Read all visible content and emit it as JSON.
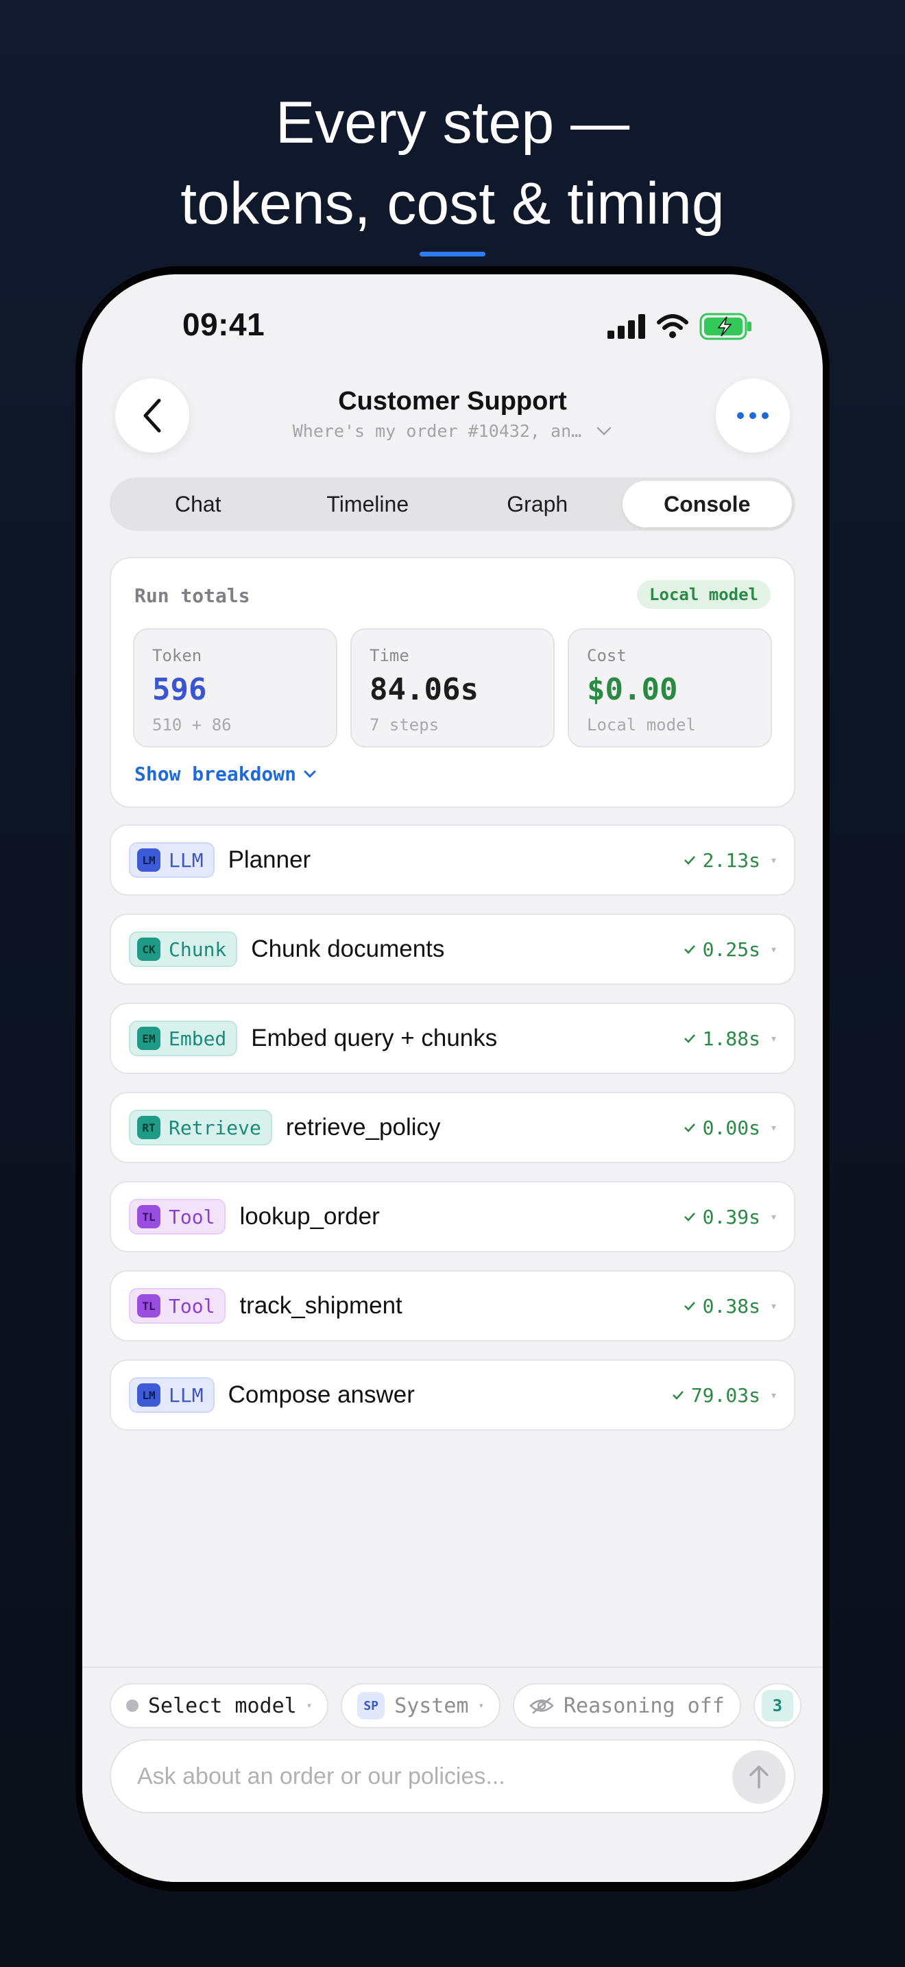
{
  "hero": {
    "line1": "Every step —",
    "line2": "tokens, cost & timing"
  },
  "status_bar": {
    "time": "09:41",
    "icons": [
      "signal-icon",
      "wifi-icon",
      "battery-charging-icon"
    ]
  },
  "header": {
    "title": "Customer Support",
    "subtitle": "Where's my order #10432, an…"
  },
  "tabs": [
    {
      "label": "Chat",
      "active": false
    },
    {
      "label": "Timeline",
      "active": false
    },
    {
      "label": "Graph",
      "active": false
    },
    {
      "label": "Console",
      "active": true
    }
  ],
  "run_totals": {
    "title": "Run totals",
    "badge": "Local model",
    "token": {
      "label": "Token",
      "value": "596",
      "sub": "510 + 86"
    },
    "time": {
      "label": "Time",
      "value": "84.06s",
      "sub": "7 steps"
    },
    "cost": {
      "label": "Cost",
      "value": "$0.00",
      "sub": "Local model"
    },
    "breakdown_label": "Show breakdown"
  },
  "steps": [
    {
      "code": "LM",
      "kind": "LLM",
      "name": "Planner",
      "time": "2.13s"
    },
    {
      "code": "CK",
      "kind": "Chunk",
      "name": "Chunk documents",
      "time": "0.25s"
    },
    {
      "code": "EM",
      "kind": "Embed",
      "name": "Embed query + chunks",
      "time": "1.88s"
    },
    {
      "code": "RT",
      "kind": "Retrieve",
      "name": "retrieve_policy",
      "time": "0.00s"
    },
    {
      "code": "TL",
      "kind": "Tool",
      "name": "lookup_order",
      "time": "0.39s"
    },
    {
      "code": "TL",
      "kind": "Tool",
      "name": "track_shipment",
      "time": "0.38s"
    },
    {
      "code": "LM",
      "kind": "LLM",
      "name": "Compose answer",
      "time": "79.03s"
    }
  ],
  "composer": {
    "model_chip": "Select model",
    "system_chip_code": "SP",
    "system_chip": "System",
    "reasoning_chip": "Reasoning off",
    "extra_chip": "3",
    "placeholder": "Ask about an order or our policies..."
  },
  "colors": {
    "accent_blue": "#1e6ad8",
    "success_green": "#2a8a43",
    "token_blue": "#3a55d0"
  }
}
